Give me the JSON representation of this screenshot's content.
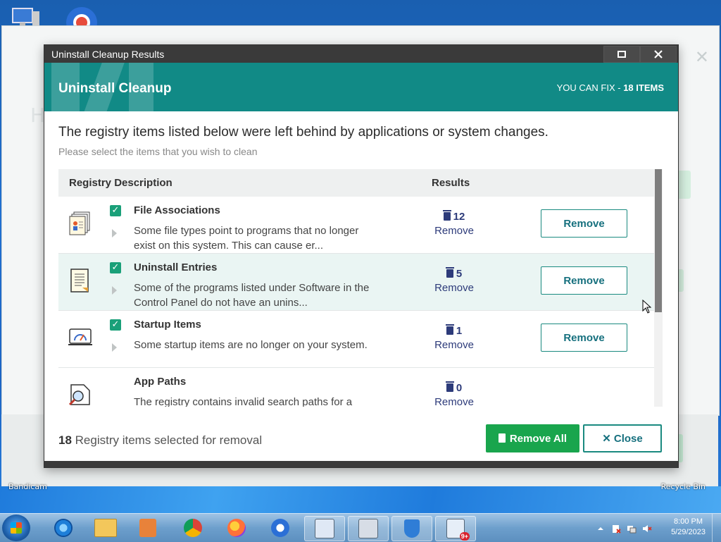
{
  "desktop": {
    "icon_left_label": "Bandicam",
    "icon_right_label": "Recycle Bin"
  },
  "dialog": {
    "window_title": "Uninstall Cleanup Results",
    "header_title": "Uninstall Cleanup",
    "can_fix_prefix": "YOU CAN FIX - ",
    "can_fix_count": "18 ITEMS",
    "intro_main": "The registry items listed below were left behind by applications or system changes.",
    "intro_sub": "Please select the items that you wish to clean",
    "columns": {
      "description": "Registry Description",
      "results": "Results"
    },
    "rows": [
      {
        "name": "File Associations",
        "description": "Some file types point to programs that no longer exist on this system. This can cause er...",
        "count": "12",
        "link": "Remove",
        "button": "Remove",
        "checked": true,
        "icon": "file-associations-icon"
      },
      {
        "name": "Uninstall Entries",
        "description": "Some of the programs listed under Software in the Control Panel do not have an unins...",
        "count": "5",
        "link": "Remove",
        "button": "Remove",
        "checked": true,
        "icon": "uninstall-entries-icon"
      },
      {
        "name": "Startup Items",
        "description": "Some startup items are no longer on your system.",
        "count": "1",
        "link": "Remove",
        "button": "Remove",
        "checked": true,
        "icon": "startup-items-icon"
      },
      {
        "name": "App Paths",
        "description": "The registry contains invalid search paths for a",
        "count": "0",
        "link": "Remove",
        "icon": "app-paths-icon"
      }
    ],
    "footer": {
      "selected_count": "18",
      "selected_text": " Registry items selected for removal",
      "remove_all": "Remove All",
      "close": "Close"
    }
  },
  "taskbar": {
    "time": "8:00 PM",
    "date": "5/29/2023",
    "notification_badge": "9+"
  },
  "colors": {
    "header_teal": "#118a86",
    "remove_all_green": "#19a54d",
    "accent_navy": "#2d3b7a"
  }
}
